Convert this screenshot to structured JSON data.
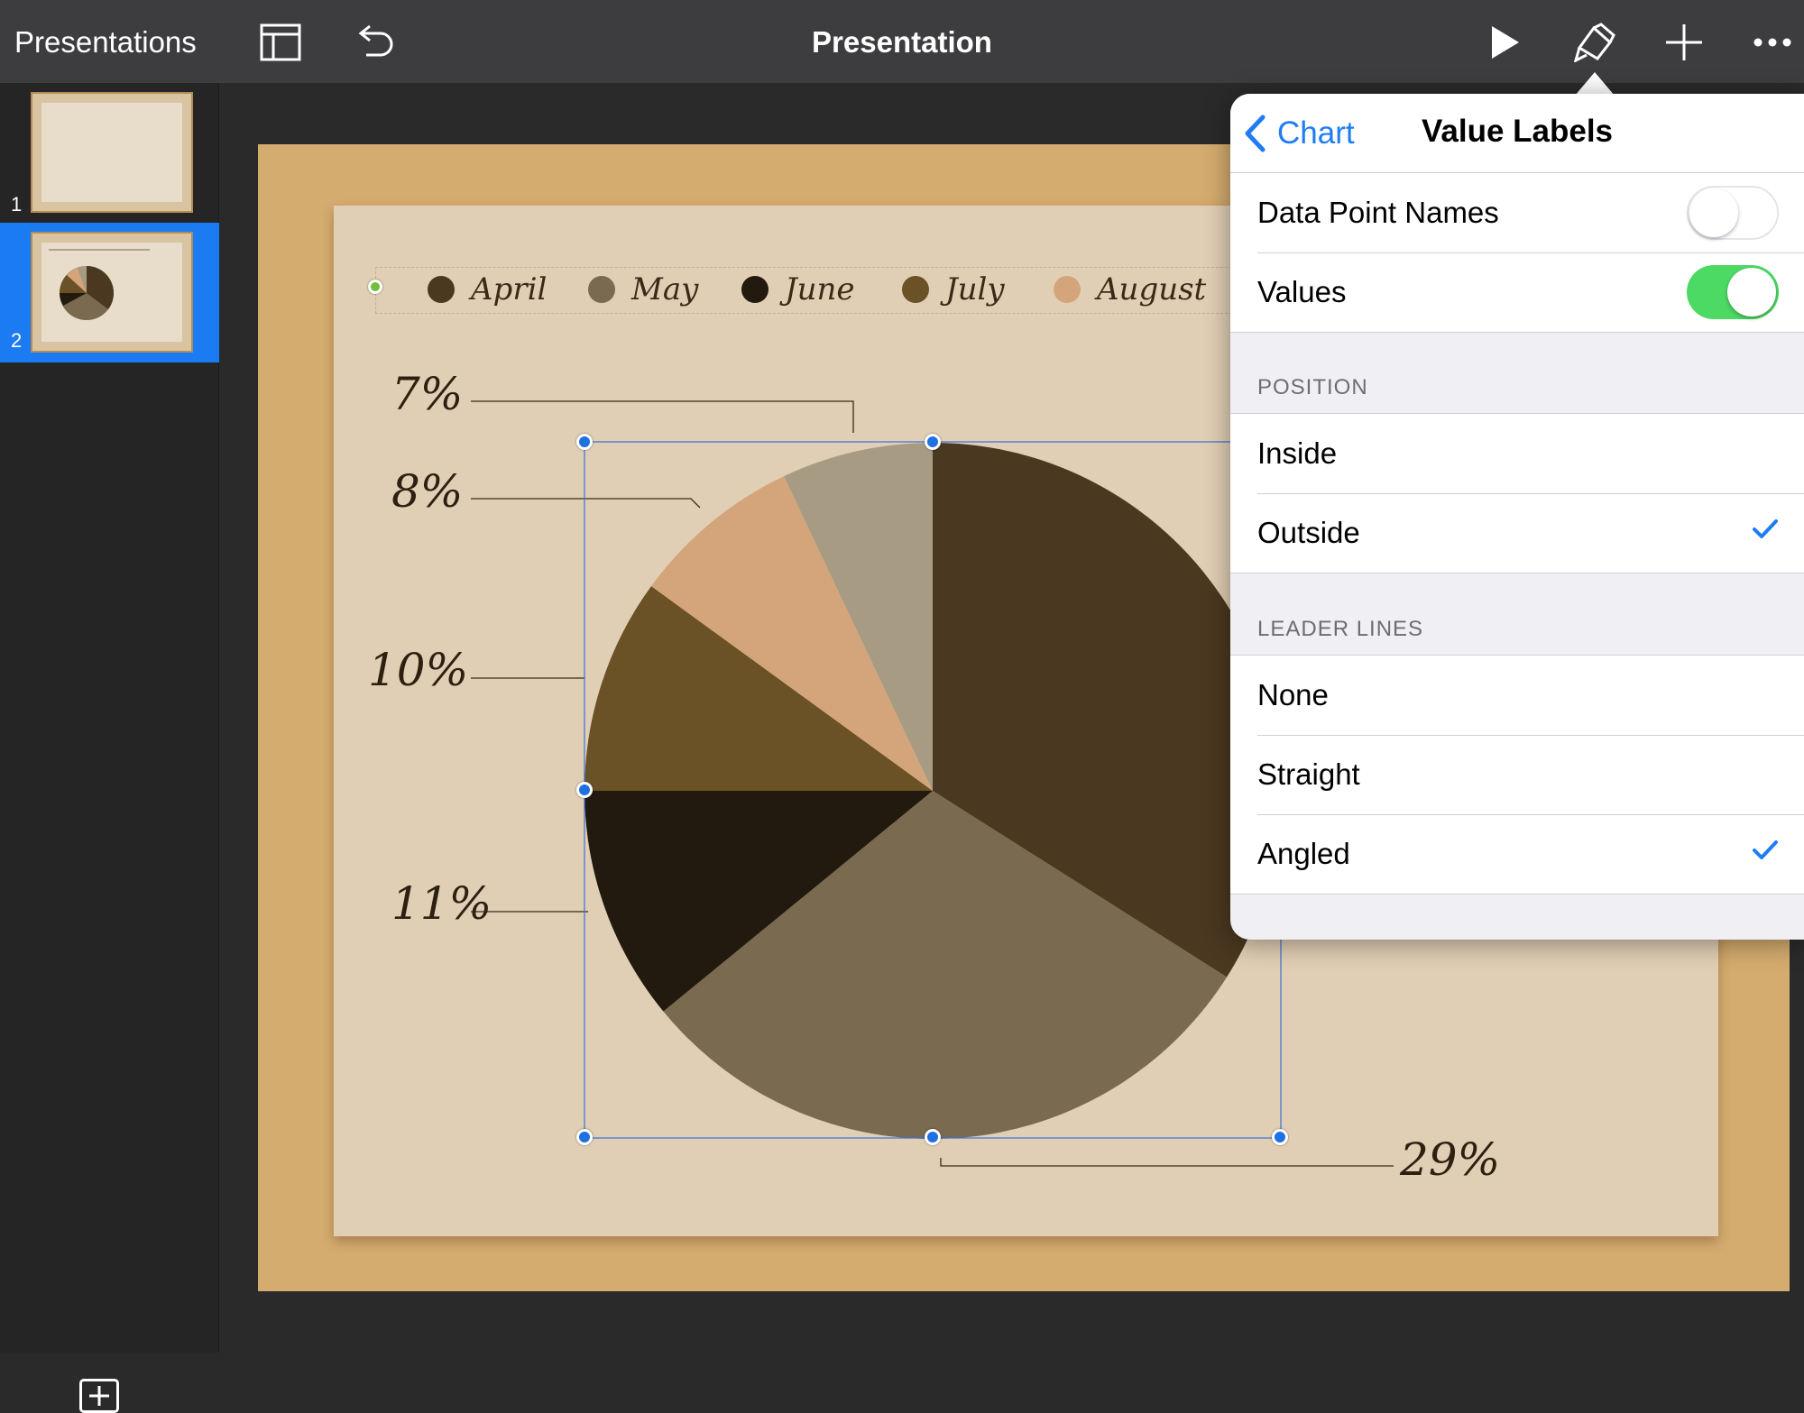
{
  "toolbar": {
    "back_label": "Presentations",
    "title": "Presentation",
    "icons": [
      "layout-icon",
      "undo-icon",
      "play-icon",
      "format-brush-icon",
      "add-icon",
      "more-icon"
    ]
  },
  "sidebar": {
    "slides": [
      {
        "number": "1",
        "selected": false
      },
      {
        "number": "2",
        "selected": true
      }
    ]
  },
  "chart_data": {
    "type": "pie",
    "categories": [
      "April",
      "May",
      "June",
      "July",
      "August"
    ],
    "value_labels": [
      "7%",
      "8%",
      "10%",
      "11%",
      "29%"
    ],
    "colors": [
      "#4a3820",
      "#7a6a4f",
      "#221a0e",
      "#6b5226",
      "#d4a57a",
      "#a89b84"
    ],
    "legend_position": "top"
  },
  "popover": {
    "back_label": "Chart",
    "title": "Value Labels",
    "toggles": [
      {
        "label": "Data Point Names",
        "on": false
      },
      {
        "label": "Values",
        "on": true
      }
    ],
    "position": {
      "header": "POSITION",
      "options": [
        {
          "label": "Inside",
          "selected": false
        },
        {
          "label": "Outside",
          "selected": true
        }
      ]
    },
    "leader_lines": {
      "header": "LEADER LINES",
      "options": [
        {
          "label": "None",
          "selected": false
        },
        {
          "label": "Straight",
          "selected": false
        },
        {
          "label": "Angled",
          "selected": true
        }
      ]
    },
    "colors": {
      "accent": "#1f7cf5",
      "toggle_on": "#4cd964",
      "toggle_off": "#e5e5ea"
    }
  }
}
